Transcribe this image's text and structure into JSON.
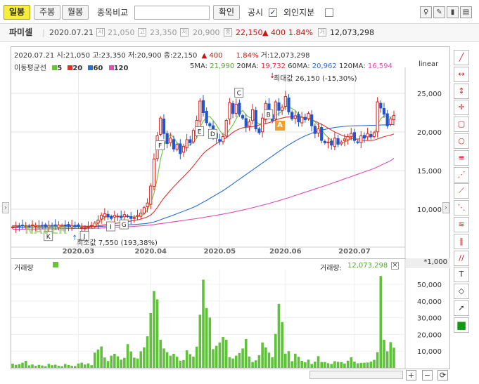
{
  "toolbar": {
    "period_buttons": [
      "일봉",
      "주봉",
      "월봉"
    ],
    "compare_label": "종목비교",
    "search_value": "",
    "confirm_label": "확인",
    "notice_label": "공시",
    "notice_checked": true,
    "foreign_label": "외인지분",
    "foreign_checked": false,
    "right_icons": [
      "bulb-icon",
      "pencil-icon",
      "chart-toggle-icon",
      "save-icon",
      "print-icon"
    ]
  },
  "info_bar": {
    "name": "파미셀",
    "date": "2020.07.21",
    "open": "21,050",
    "high": "23,350",
    "low": "20,900",
    "close": "22,150",
    "change": "▲ 400",
    "change_pct": "1.84%",
    "volume": "12,073,298"
  },
  "legend_line": {
    "date": "2020.07.21",
    "open_label": "시:",
    "open": "21,050",
    "high_label": "고:",
    "high": "23,350",
    "low_label": "저:",
    "low": "20,900",
    "close_label": "종:",
    "close": "22,150",
    "change": "▲  400",
    "change_pct": "1.84%",
    "volume_label": "거:",
    "volume": "12,073,298"
  },
  "ma_legend": {
    "title": "이동평균선",
    "items": [
      {
        "label": "5",
        "color": "#6ac23b"
      },
      {
        "label": "20",
        "color": "#e03030"
      },
      {
        "label": "60",
        "color": "#2b6fd6"
      },
      {
        "label": "120",
        "color": "#e04fb0"
      }
    ],
    "values": [
      {
        "label": "5MA:",
        "value": "21,990",
        "color": "#4fa82a"
      },
      {
        "label": "20MA:",
        "value": "19,732",
        "color": "#e03030"
      },
      {
        "label": "60MA:",
        "value": "20,962",
        "color": "#2b6fd6"
      },
      {
        "label": "120MA:",
        "value": "16,594",
        "color": "#e04fb0"
      }
    ],
    "scale": "linear"
  },
  "annotations": {
    "max": "최대값 26,150 (-15,30%)",
    "min": "최소값 7,550 (193,38%)",
    "letters": [
      "K",
      "J",
      "I",
      "G",
      "F",
      "E",
      "D",
      "C",
      "B"
    ],
    "marker_a": "A"
  },
  "volume_panel": {
    "title": "거래량",
    "value_label": "거래량:",
    "value": "12,073,298",
    "multiplier": "*1,000",
    "close_icon": "×"
  },
  "chart_data": [
    {
      "type": "candlestick",
      "title": "파미셀",
      "x_ticks": [
        "2020.03",
        "2020.04",
        "2020.05",
        "2020.06",
        "2020.07"
      ],
      "y_ticks": [
        "10,000",
        "15,000",
        "20,000",
        "25,000"
      ],
      "ylim": [
        6000,
        28000
      ],
      "scale": "linear",
      "closes": [
        7700,
        7800,
        7750,
        7900,
        7850,
        7800,
        7950,
        7900,
        7850,
        7800,
        7750,
        7900,
        7850,
        7800,
        7950,
        7900,
        7850,
        7800,
        7900,
        7850,
        7750,
        7600,
        7550,
        7700,
        7900,
        8200,
        8600,
        9200,
        9400,
        9000,
        8800,
        9200,
        9100,
        8900,
        9300,
        9100,
        8800,
        8900,
        9200,
        9500,
        10200,
        10800,
        13000,
        16500,
        19500,
        21800,
        19800,
        18500,
        19200,
        17800,
        18400,
        17200,
        18100,
        19000,
        18600,
        20200,
        21500,
        24000,
        22500,
        21200,
        20800,
        19700,
        19200,
        18800,
        19400,
        21500,
        23800,
        22400,
        23600,
        22300,
        21800,
        20700,
        21300,
        22900,
        20400,
        19900,
        21800,
        23700,
        22200,
        21500,
        23900,
        22800,
        23200,
        24600,
        22600,
        21700,
        22100,
        21300,
        21900,
        21600,
        22400,
        20800,
        19800,
        20400,
        18900,
        18600,
        18700,
        18300,
        19200,
        18400,
        18700,
        19100,
        19400,
        19800,
        18900,
        18700,
        19500,
        19200,
        19800,
        19400,
        19900,
        23900,
        23100,
        22300,
        20800,
        21700,
        22150
      ],
      "ma": {
        "5": [
          7800,
          7820,
          7810,
          7830,
          7840,
          7830,
          7860,
          7850,
          7860,
          7840,
          7830,
          7850,
          7840,
          7830,
          7860,
          7860,
          7860,
          7830,
          7860,
          7840,
          7810,
          7740,
          7650,
          7640,
          7660,
          7840,
          8160,
          8600,
          8940,
          9100,
          9060,
          9100,
          9100,
          9000,
          9060,
          9080,
          9040,
          9000,
          9060,
          9160,
          9400,
          9880,
          10840,
          12000,
          14000,
          16500,
          18200,
          19200,
          19700,
          19300,
          18600,
          18300,
          18100,
          18300,
          18300,
          18700,
          19200,
          20600,
          21400,
          21900,
          22000,
          21500,
          20900,
          20200,
          19600,
          19700,
          20300,
          20900,
          21700,
          22400,
          22800,
          22200,
          21900,
          21800,
          21400,
          21000,
          21200,
          21700,
          22000,
          21800,
          22200,
          22400,
          22700,
          23300,
          23300,
          23000,
          22800,
          22200,
          21900,
          21700,
          21900,
          21600,
          21300,
          20900,
          20300,
          19700,
          19300,
          18900,
          18700,
          18600,
          18600,
          18700,
          18900,
          19100,
          19200,
          19100,
          19200,
          19300,
          19400,
          19300,
          19600,
          20900,
          21700,
          22100,
          22000,
          21900,
          21990
        ],
        "20": [
          7850,
          7850,
          7840,
          7840,
          7830,
          7830,
          7830,
          7830,
          7830,
          7830,
          7830,
          7830,
          7830,
          7830,
          7830,
          7830,
          7830,
          7830,
          7830,
          7830,
          7820,
          7810,
          7800,
          7800,
          7800,
          7810,
          7840,
          7900,
          7980,
          8040,
          8090,
          8150,
          8210,
          8270,
          8340,
          8400,
          8470,
          8540,
          8620,
          8720,
          8850,
          9010,
          9250,
          9650,
          10200,
          10850,
          11450,
          11950,
          12450,
          12900,
          13350,
          13800,
          14200,
          14650,
          15100,
          15600,
          16150,
          16700,
          17200,
          17600,
          17900,
          18200,
          18500,
          18750,
          19000,
          19250,
          19600,
          19950,
          20200,
          20400,
          20550,
          20600,
          20650,
          20700,
          20800,
          20900,
          21000,
          21100,
          21200,
          21350,
          21550,
          21700,
          21800,
          21900,
          21950,
          22000,
          22050,
          22000,
          21900,
          21800,
          21700,
          21600,
          21400,
          21200,
          21000,
          20750,
          20500,
          20250,
          20000,
          19800,
          19600,
          19450,
          19300,
          19200,
          19100,
          19000,
          18950,
          18900,
          18900,
          18900,
          18950,
          19100,
          19250,
          19400,
          19500,
          19600,
          19732
        ],
        "60": [
          7600,
          7600,
          7610,
          7620,
          7620,
          7630,
          7640,
          7640,
          7650,
          7660,
          7660,
          7670,
          7670,
          7680,
          7690,
          7690,
          7700,
          7700,
          7710,
          7720,
          7720,
          7720,
          7720,
          7720,
          7730,
          7740,
          7760,
          7780,
          7800,
          7820,
          7840,
          7860,
          7880,
          7900,
          7930,
          7960,
          7990,
          8020,
          8050,
          8080,
          8120,
          8170,
          8250,
          8350,
          8480,
          8640,
          8800,
          8950,
          9100,
          9250,
          9420,
          9580,
          9740,
          9900,
          10070,
          10250,
          10450,
          10680,
          10920,
          11150,
          11400,
          11650,
          11900,
          12150,
          12400,
          12680,
          12980,
          13280,
          13580,
          13880,
          14180,
          14480,
          14780,
          15080,
          15380,
          15680,
          15980,
          16280,
          16580,
          16880,
          17180,
          17480,
          17780,
          18060,
          18330,
          18590,
          18840,
          19070,
          19290,
          19490,
          19670,
          19830,
          19980,
          20110,
          20230,
          20340,
          20430,
          20510,
          20580,
          20640,
          20690,
          20730,
          20760,
          20780,
          20800,
          20810,
          20820,
          20830,
          20840,
          20850,
          20860,
          20880,
          20900,
          20920,
          20940,
          20950,
          20962
        ],
        "120": [
          7400,
          7410,
          7410,
          7420,
          7420,
          7430,
          7430,
          7440,
          7440,
          7450,
          7450,
          7460,
          7460,
          7470,
          7470,
          7480,
          7480,
          7490,
          7490,
          7500,
          7500,
          7510,
          7510,
          7520,
          7520,
          7530,
          7540,
          7560,
          7580,
          7600,
          7620,
          7640,
          7660,
          7680,
          7700,
          7720,
          7750,
          7780,
          7810,
          7840,
          7870,
          7910,
          7960,
          8010,
          8070,
          8130,
          8190,
          8250,
          8310,
          8370,
          8430,
          8490,
          8550,
          8610,
          8670,
          8730,
          8790,
          8860,
          8930,
          9000,
          9070,
          9140,
          9210,
          9290,
          9370,
          9450,
          9530,
          9620,
          9710,
          9800,
          9890,
          9990,
          10090,
          10190,
          10300,
          10410,
          10520,
          10630,
          10740,
          10860,
          10980,
          11110,
          11240,
          11370,
          11500,
          11640,
          11780,
          11920,
          12060,
          12200,
          12340,
          12480,
          12620,
          12760,
          12900,
          13040,
          13180,
          13330,
          13480,
          13630,
          13780,
          13930,
          14080,
          14230,
          14380,
          14530,
          14680,
          14830,
          14980,
          15130,
          15280,
          15480,
          15680,
          15880,
          16080,
          16280,
          16594
        ]
      },
      "max_label_value": 26150,
      "min_label_value": 7550
    },
    {
      "type": "bar",
      "title": "거래량",
      "y_ticks": [
        "10,000",
        "20,000",
        "30,000",
        "40,000",
        "50,000"
      ],
      "ylim": [
        0,
        58000
      ],
      "unit": "*1,000",
      "values": [
        2500,
        1800,
        2200,
        3100,
        4200,
        1500,
        2000,
        1200,
        1800,
        1400,
        1000,
        2400,
        1600,
        1900,
        1200,
        1000,
        2300,
        1700,
        1200,
        1100,
        2600,
        3100,
        2000,
        2700,
        1600,
        9100,
        11000,
        12800,
        6200,
        4100,
        7300,
        8400,
        6900,
        4900,
        6000,
        14200,
        9800,
        6100,
        5600,
        9900,
        12300,
        18900,
        32800,
        46000,
        41000,
        16800,
        11600,
        9400,
        7300,
        8400,
        6700,
        4300,
        4700,
        10500,
        8200,
        6700,
        12700,
        31800,
        52800,
        35800,
        30100,
        11200,
        13200,
        15200,
        18500,
        16800,
        6400,
        5600,
        7300,
        8900,
        11600,
        17200,
        6800,
        3500,
        4500,
        7600,
        15200,
        12200,
        9100,
        6300,
        20300,
        38300,
        27400,
        8500,
        10000,
        4000,
        8500,
        6600,
        4200,
        3300,
        4900,
        2300,
        3700,
        7000,
        3500,
        3500,
        2800,
        2300,
        4000,
        3600,
        3400,
        2600,
        4300,
        6300,
        3700,
        2700,
        3000,
        3100,
        3200,
        3700,
        4800,
        9400,
        55000,
        16800,
        9900,
        15400,
        12073
      ]
    }
  ],
  "right_tools": [
    "diagonal-line-icon",
    "horizontal-arrow-icon",
    "vertical-arrow-icon",
    "crosshair-icon",
    "rectangle-icon",
    "circle-icon",
    "fibo-icon",
    "fibo-fan-icon",
    "speed-line-icon",
    "gann-fan-icon",
    "channel-icon",
    "cycle-icon",
    "parallel-icon",
    "text-icon",
    "eraser-icon",
    "pointer-icon",
    "color-icon"
  ],
  "zoom_buttons": [
    "+",
    "−",
    "⟳"
  ]
}
